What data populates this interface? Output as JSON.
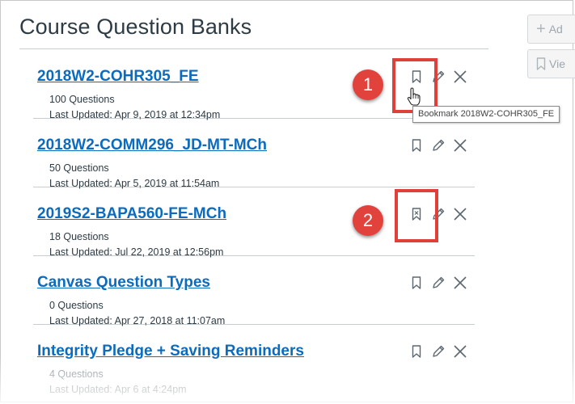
{
  "page": {
    "title": "Course Question Banks",
    "add_label": "Ad",
    "view_label": "Vie"
  },
  "banks": [
    {
      "name": "2018W2-COHR305_FE",
      "count": "100 Questions",
      "updated": "Last Updated: Apr 9, 2019 at 12:34pm",
      "bookmarked": false
    },
    {
      "name": "2018W2-COMM296_JD-MT-MCh",
      "count": "50 Questions",
      "updated": "Last Updated: Apr 5, 2019 at 11:54am",
      "bookmarked": false
    },
    {
      "name": "2019S2-BAPA560-FE-MCh",
      "count": "18 Questions",
      "updated": "Last Updated: Jul 22, 2019 at 12:56pm",
      "bookmarked": true
    },
    {
      "name": "Canvas Question Types",
      "count": "0 Questions",
      "updated": "Last Updated: Apr 27, 2018 at 11:07am",
      "bookmarked": false
    },
    {
      "name": "Integrity Pledge + Saving Reminders",
      "count": "4 Questions",
      "updated": "Last Updated: Apr 6 at 4:24pm",
      "bookmarked": false
    }
  ],
  "tooltip": "Bookmark 2018W2-COHR305_FE",
  "callouts": [
    "1",
    "2"
  ],
  "icons": {
    "bookmark": "bookmark-icon",
    "bookmarked": "bookmark-remove-icon",
    "edit": "pencil-icon",
    "delete": "close-icon",
    "add": "plus-icon",
    "view": "bookmark-icon",
    "cursor": "hand-pointer-icon"
  },
  "colors": {
    "link": "#0a6bbf",
    "text": "#2d3b45",
    "highlight": "#e0403a",
    "callout": "#e2423c"
  }
}
